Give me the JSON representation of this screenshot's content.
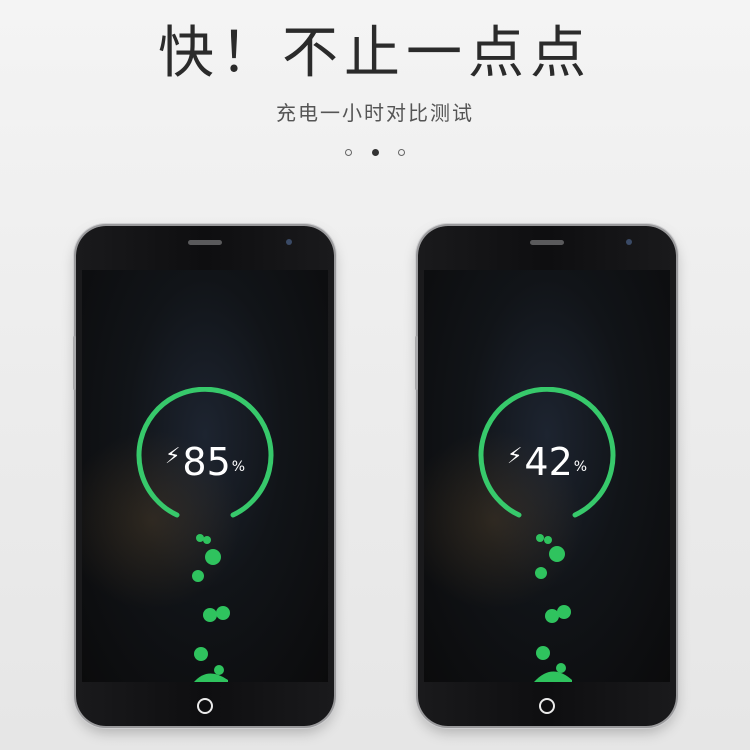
{
  "headline": "快！不止一点点",
  "subtitle": "充电一小时对比测试",
  "carousel": {
    "count": 3,
    "active_index": 1
  },
  "phones": [
    {
      "bolt_icon": "⚡",
      "value": "85",
      "unit": "%",
      "charge_level": 85
    },
    {
      "bolt_icon": "⚡",
      "value": "42",
      "unit": "%",
      "charge_level": 42
    }
  ],
  "colors": {
    "ring_green": "#37c96b",
    "bubble_green": "#2fc35e",
    "text": "#2b2b2b"
  }
}
